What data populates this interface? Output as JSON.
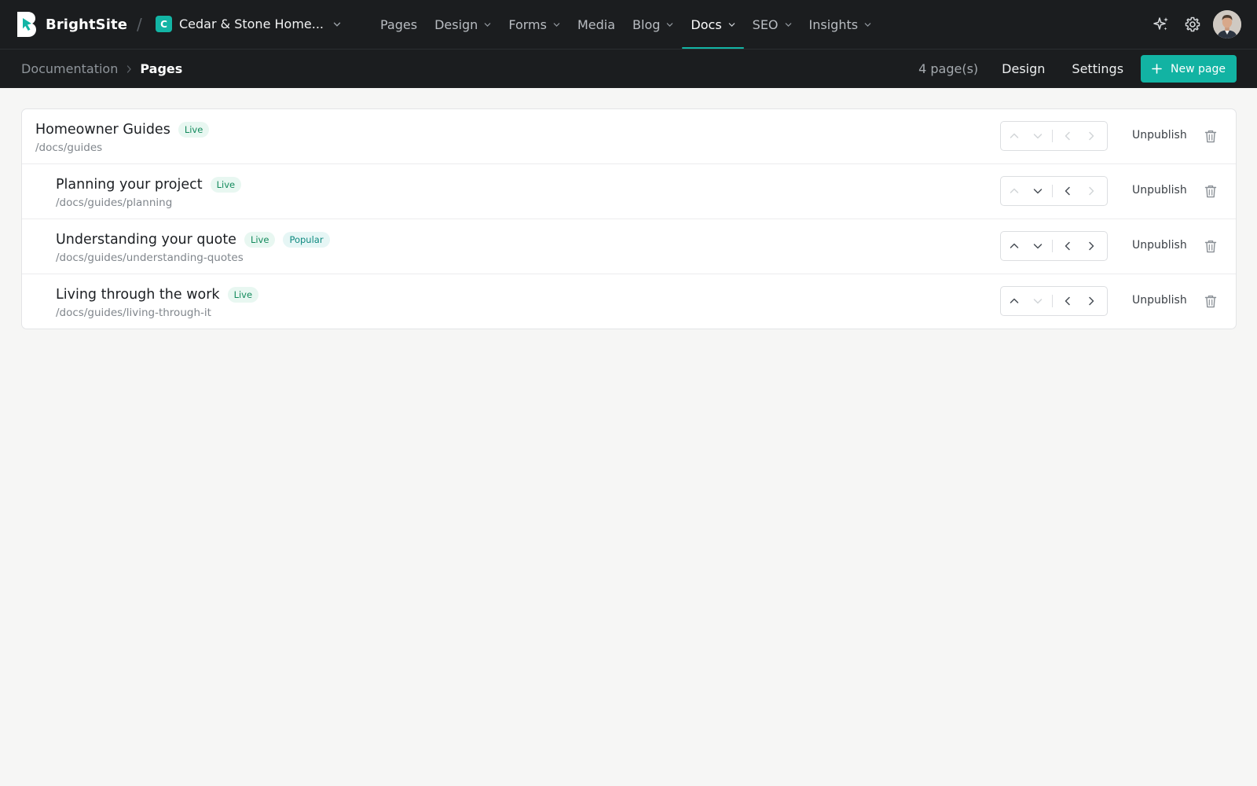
{
  "app": {
    "brand_name": "BrightSite",
    "brand_color": "#13b5a5",
    "separator": "/",
    "site": {
      "initial": "C",
      "name": "Cedar & Stone Home..."
    }
  },
  "nav": {
    "items": [
      {
        "label": "Pages",
        "has_menu": false,
        "active": false
      },
      {
        "label": "Design",
        "has_menu": true,
        "active": false
      },
      {
        "label": "Forms",
        "has_menu": true,
        "active": false
      },
      {
        "label": "Media",
        "has_menu": false,
        "active": false
      },
      {
        "label": "Blog",
        "has_menu": true,
        "active": false
      },
      {
        "label": "Docs",
        "has_menu": true,
        "active": true
      },
      {
        "label": "SEO",
        "has_menu": true,
        "active": false
      },
      {
        "label": "Insights",
        "has_menu": true,
        "active": false
      }
    ],
    "actions": [
      "sparkle-icon",
      "gear-icon",
      "user-avatar"
    ]
  },
  "subbar": {
    "breadcrumb": {
      "parent": "Documentation",
      "current": "Pages"
    },
    "page_count": "4 page(s)",
    "design_label": "Design",
    "settings_label": "Settings",
    "new_page_label": "New page"
  },
  "pages": [
    {
      "title": "Homeowner Guides",
      "path": "/docs/guides",
      "badges": [
        "Live"
      ],
      "level": 0,
      "action_label": "Unpublish",
      "controls": {
        "up": false,
        "down": false,
        "outdent": false,
        "indent": false
      }
    },
    {
      "title": "Planning your project",
      "path": "/docs/guides/planning",
      "badges": [
        "Live"
      ],
      "level": 1,
      "action_label": "Unpublish",
      "controls": {
        "up": false,
        "down": true,
        "outdent": true,
        "indent": false
      }
    },
    {
      "title": "Understanding your quote",
      "path": "/docs/guides/understanding-quotes",
      "badges": [
        "Live",
        "Popular"
      ],
      "level": 1,
      "action_label": "Unpublish",
      "controls": {
        "up": true,
        "down": true,
        "outdent": true,
        "indent": true
      }
    },
    {
      "title": "Living through the work",
      "path": "/docs/guides/living-through-it",
      "badges": [
        "Live"
      ],
      "level": 1,
      "action_label": "Unpublish",
      "controls": {
        "up": true,
        "down": false,
        "outdent": true,
        "indent": true
      }
    }
  ]
}
